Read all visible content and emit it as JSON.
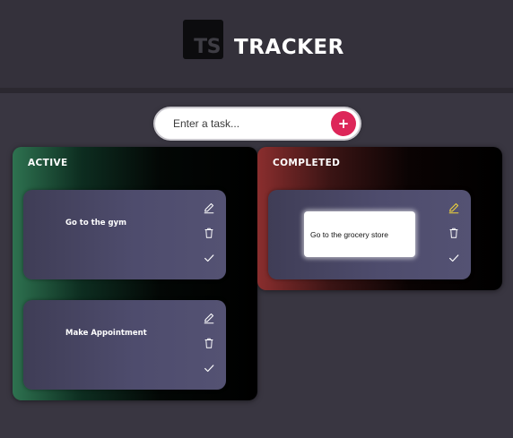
{
  "header": {
    "logo_text": "TS",
    "title": "TRACKER"
  },
  "task_input": {
    "placeholder": "Enter a task...",
    "value": "",
    "add_label": "+"
  },
  "columns": [
    {
      "title": "ACTIVE",
      "cards": [
        {
          "text": "Go to the gym"
        },
        {
          "text": "Make Appointment"
        }
      ]
    },
    {
      "title": "COMPLETED",
      "cards": [
        {
          "edit_value": "Go to the grocery store"
        }
      ]
    }
  ],
  "icons": {
    "edit": "pencil-icon",
    "delete": "trash-icon",
    "done": "check-icon"
  },
  "colors": {
    "background": "#393641",
    "add_button": "#dd2659",
    "active_accent": "#2e7250",
    "completed_accent": "#8a2e2e",
    "editing_icon": "#f0d43a"
  }
}
